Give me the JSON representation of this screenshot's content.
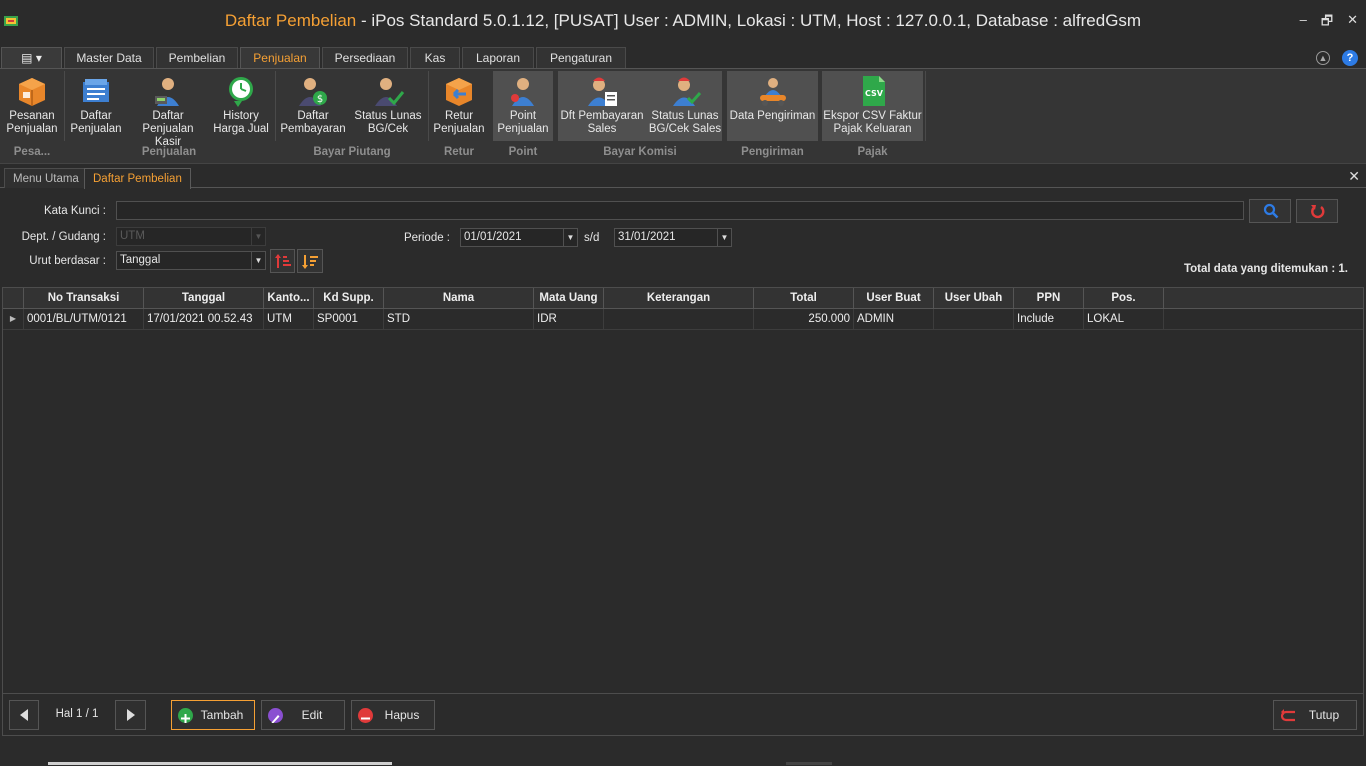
{
  "titlebar": {
    "title_main": "Daftar Pembelian",
    "title_rest": " - iPos Standard 5.0.1.12, [PUSAT] User : ADMIN, Lokasi : UTM, Host : 127.0.0.1, Database : alfredGsm",
    "minimize": "–",
    "restore": "🗗",
    "close": "✕"
  },
  "menu_tabs": [
    {
      "label": "Master Data"
    },
    {
      "label": "Pembelian"
    },
    {
      "label": "Penjualan"
    },
    {
      "label": "Persediaan"
    },
    {
      "label": "Kas"
    },
    {
      "label": "Laporan"
    },
    {
      "label": "Pengaturan"
    }
  ],
  "active_menu_tab": "Penjualan",
  "app_menu_label": "▤ ▾",
  "ribbon": {
    "buttons": [
      {
        "line1": "Pesanan",
        "line2": "Penjualan",
        "icon": "order-box-icon"
      },
      {
        "line1": "Daftar",
        "line2": "Penjualan",
        "icon": "sales-list-icon"
      },
      {
        "line1": "Daftar",
        "line2": "Penjualan Kasir",
        "icon": "cashier-icon"
      },
      {
        "line1": "History",
        "line2": "Harga Jual",
        "icon": "history-clock-icon"
      },
      {
        "line1": "Daftar",
        "line2": "Pembayaran",
        "icon": "payment-person-icon"
      },
      {
        "line1": "Status Lunas",
        "line2": "BG/Cek",
        "icon": "paid-check-icon"
      },
      {
        "line1": "Retur",
        "line2": "Penjualan",
        "icon": "return-box-icon"
      },
      {
        "line1": "Point",
        "line2": "Penjualan",
        "icon": "point-person-icon"
      },
      {
        "line1": "Dft Pembayaran",
        "line2": "Sales",
        "icon": "sales-payment-icon"
      },
      {
        "line1": "Status Lunas",
        "line2": "BG/Cek Sales",
        "icon": "sales-check-icon"
      },
      {
        "line1": "Data Pengiriman",
        "line2": "",
        "icon": "delivery-icon"
      },
      {
        "line1": "Ekspor CSV Faktur",
        "line2": "Pajak Keluaran",
        "icon": "csv-icon"
      }
    ],
    "groups": [
      "Pesa...",
      "Penjualan",
      "Bayar Piutang",
      "Retur",
      "Point",
      "Bayar Komisi",
      "Pengiriman",
      "Pajak"
    ]
  },
  "doc_tabs": [
    {
      "label": "Menu Utama"
    },
    {
      "label": "Daftar Pembelian"
    }
  ],
  "form": {
    "kata_kunci_label": "Kata Kunci :",
    "kata_kunci_value": "",
    "dept_label": "Dept. / Gudang :",
    "dept_value": "UTM",
    "urut_label": "Urut berdasar :",
    "urut_value": "Tanggal",
    "periode_label": "Periode :",
    "periode_from": "01/01/2021",
    "sd_label": "s/d",
    "periode_to": "31/01/2021",
    "total_label": "Total data yang ditemukan : 1."
  },
  "grid": {
    "columns": [
      "No Transaksi",
      "Tanggal",
      "Kanto...",
      "Kd Supp.",
      "Nama",
      "Mata Uang",
      "Keterangan",
      "Total",
      "User Buat",
      "User Ubah",
      "PPN",
      "Pos."
    ],
    "rows": [
      [
        "0001/BL/UTM/0121",
        "17/01/2021 00.52.43",
        "UTM",
        "SP0001",
        "STD",
        "IDR",
        "",
        "250.000",
        "ADMIN",
        "",
        "Include",
        "LOKAL"
      ]
    ]
  },
  "bottom": {
    "page_label": "Hal 1 / 1",
    "tambah": "Tambah",
    "edit": "Edit",
    "hapus": "Hapus",
    "tutup": "Tutup"
  },
  "colors": {
    "accent": "#f5a034",
    "background": "#2b2b2b",
    "search_blue": "#2d7be5",
    "delete_red": "#e03a3a"
  }
}
